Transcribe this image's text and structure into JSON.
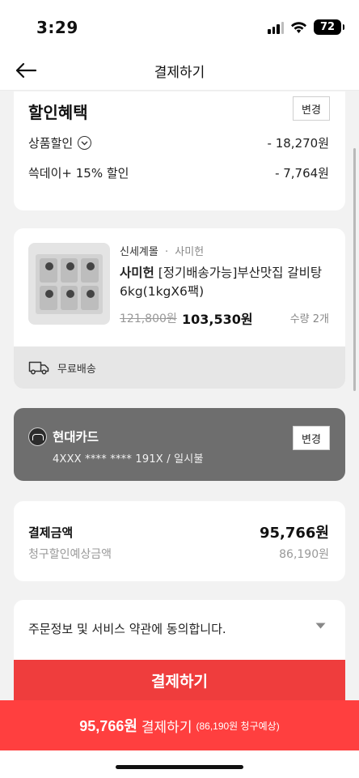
{
  "status_bar": {
    "time": "3:29",
    "battery": "72"
  },
  "nav": {
    "title": "결제하기"
  },
  "discount": {
    "title": "할인혜택",
    "change_label": "변경",
    "rows": [
      {
        "label": "상품할인",
        "value": "- 18,270원"
      },
      {
        "label": "쓱데이+ 15% 할인",
        "value": "- 7,764원"
      }
    ]
  },
  "product": {
    "seller": "신세계몰",
    "separator": "·",
    "brand": "사미헌",
    "name_brand": "사미헌",
    "name_rest": " [정기배송가능]부산맛집 갈비탕 6kg(1kgX6팩)",
    "original_price": "121,800원",
    "sale_price": "103,530원",
    "quantity": "수량 2개",
    "shipping": "무료배송"
  },
  "payment_method": {
    "card_name": "현대카드",
    "card_number": "4XXX **** **** 191X / 일시불",
    "change_label": "변경"
  },
  "totals": {
    "label": "결제금액",
    "value": "95,766원",
    "expected_label": "청구할인예상금액",
    "expected_value": "86,190원"
  },
  "agreement": {
    "text": "주문정보 및 서비스 약관에 동의합니다."
  },
  "pay_button": {
    "label": "결제하기"
  },
  "pay_bar": {
    "amount": "95,766원",
    "label": "결제하기",
    "sub": "(86,190원 청구예상)"
  },
  "icons": {
    "back": "arrow-left-icon",
    "shipping": "truck-icon",
    "discount_detail": "chevron-down-circle-icon",
    "agreement_expand": "caret-down-icon"
  },
  "colors": {
    "accent_red": "#ff3f3f",
    "payment_card_bg": "#6e6e6e",
    "coupon_outline": "#5a32d8"
  }
}
